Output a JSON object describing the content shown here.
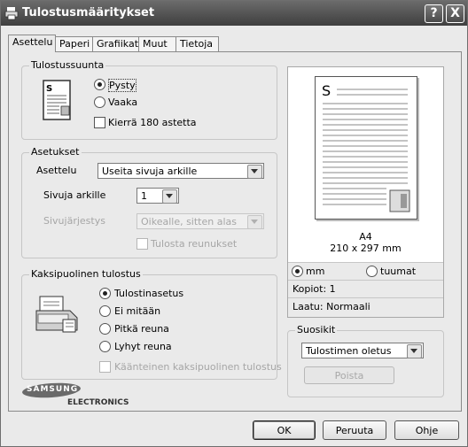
{
  "window": {
    "title": "Tulostusmääritykset",
    "help_label": "?",
    "close_label": "X"
  },
  "tabs": [
    {
      "label": "Asettelu"
    },
    {
      "label": "Paperi"
    },
    {
      "label": "Grafiikat"
    },
    {
      "label": "Muut"
    },
    {
      "label": "Tietoja"
    }
  ],
  "orientation": {
    "group_label": "Tulostussuunta",
    "portrait_label": "Pysty",
    "landscape_label": "Vaaka",
    "rotate_label": "Kierrä 180 astetta",
    "selected": "Pysty"
  },
  "settings": {
    "group_label": "Asetukset",
    "layout_label": "Asettelu",
    "layout_value": "Useita sivuja arkille",
    "pages_per_sheet_label": "Sivuja arkille",
    "pages_per_sheet_value": "1",
    "page_order_label": "Sivujärjestys",
    "page_order_value": "Oikealle, sitten alas",
    "print_borders_label": "Tulosta reunukset"
  },
  "duplex": {
    "group_label": "Kaksipuolinen tulostus",
    "options": [
      "Tulostinasetus",
      "Ei mitään",
      "Pitkä reuna",
      "Lyhyt reuna"
    ],
    "selected": "Tulostinasetus",
    "reverse_label": "Käänteinen kaksipuolinen tulostus"
  },
  "brand": {
    "name": "SAMSUNG",
    "sub": "ELECTRONICS"
  },
  "preview": {
    "page_letter": "S",
    "paper_name": "A4",
    "paper_size": "210 x 297 mm",
    "unit_mm_label": "mm",
    "unit_inch_label": "tuumat",
    "selected_unit": "mm",
    "copies_text": "Kopiot: 1",
    "quality_text": "Laatu: Normaali"
  },
  "favorites": {
    "group_label": "Suosikit",
    "value": "Tulostimen oletus",
    "delete_label": "Poista"
  },
  "buttons": {
    "ok": "OK",
    "cancel": "Peruuta",
    "help": "Ohje"
  },
  "colors": {
    "titlebar": "#4a4a4a",
    "panel": "#eaeaea"
  }
}
